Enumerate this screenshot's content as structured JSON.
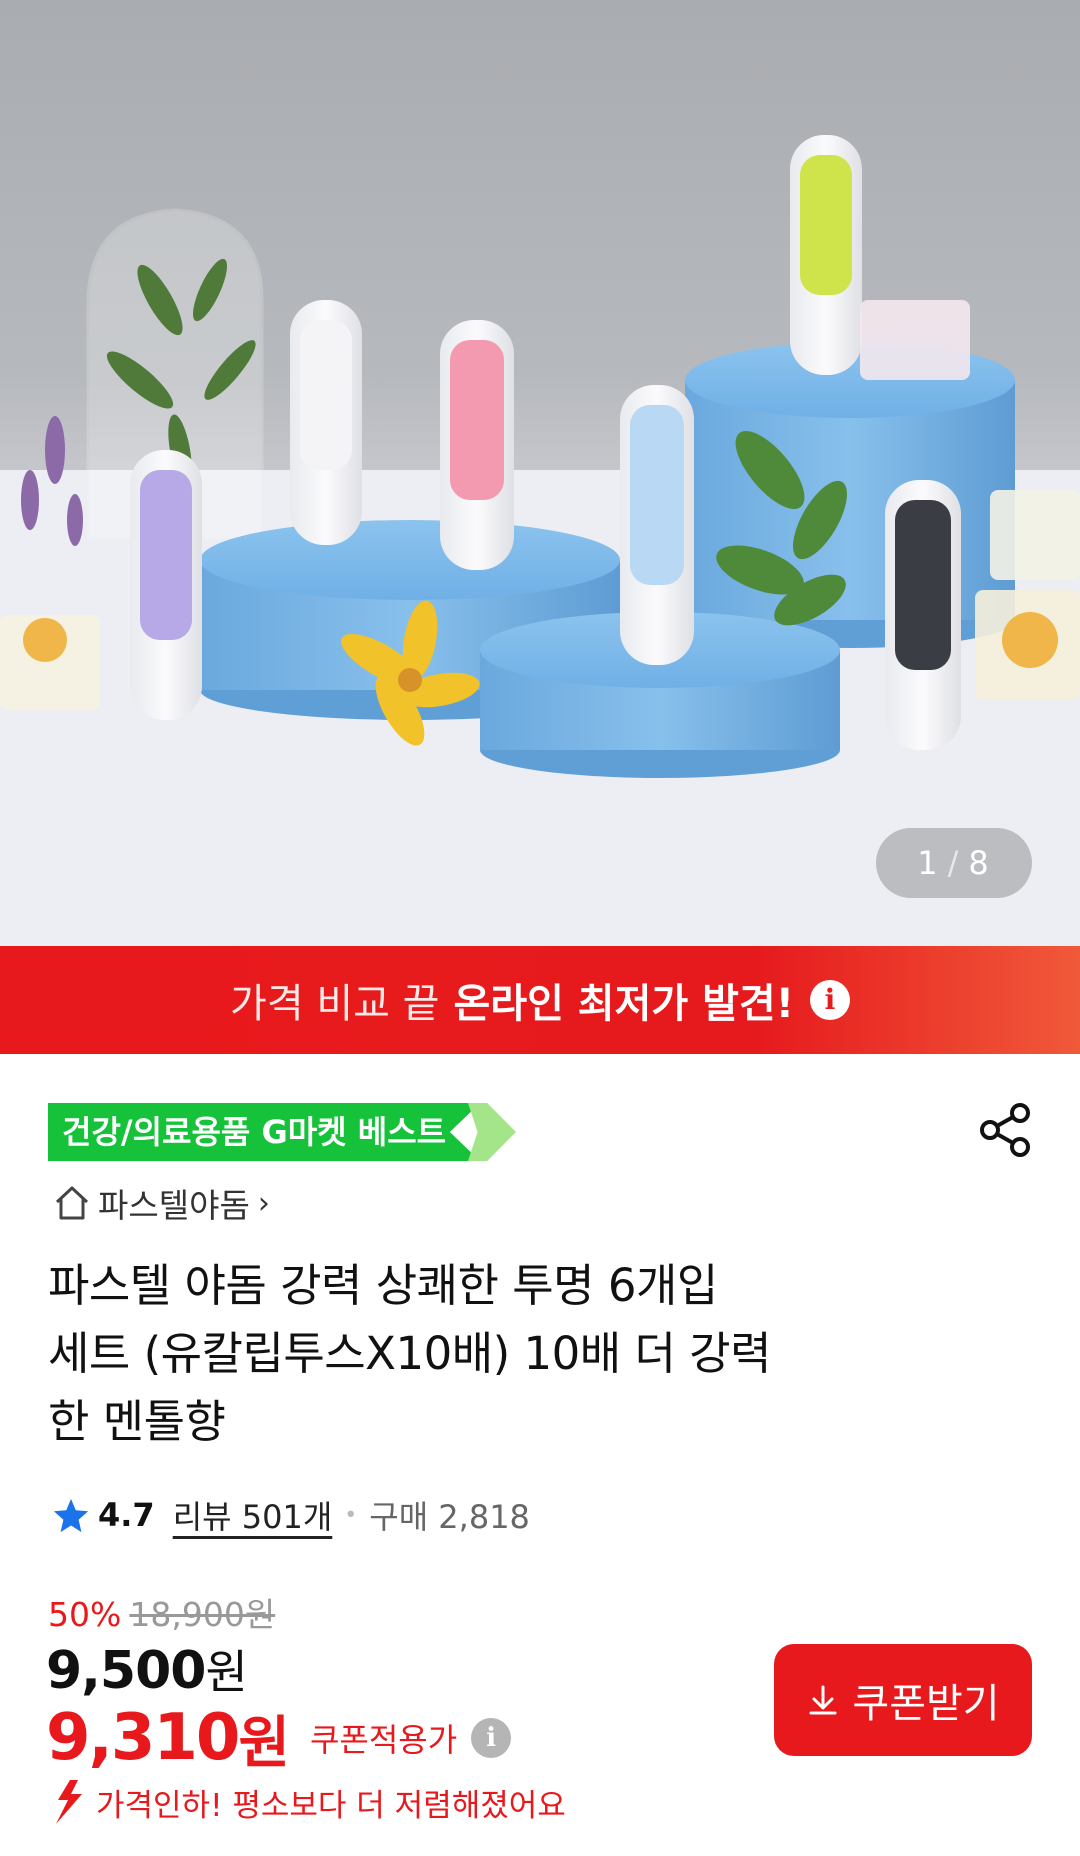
{
  "gallery": {
    "current": "1",
    "separator": "/",
    "total": "8"
  },
  "banner": {
    "light_text": "가격 비교 끝",
    "bold_text": "온라인 최저가 발견!",
    "info_icon": "info-icon"
  },
  "badge": {
    "label": "건강/의료용품 G마켓 베스트"
  },
  "share": {
    "icon": "share-icon"
  },
  "store": {
    "name": "파스텔야돔",
    "icon": "home-icon"
  },
  "product": {
    "title_line1": "파스텔 야돔 강력 상쾌한 투명 6개입",
    "title_line2": "세트 (유칼립투스X10배) 10배 더 강력",
    "title_line3": "한 멘톨향"
  },
  "rating": {
    "score": "4.7",
    "review": "리뷰 501개",
    "purchase": "구매 2,818"
  },
  "price": {
    "discount": "50%",
    "original": "18,900원",
    "sale": "9,500",
    "sale_unit": "원",
    "coupon_amount": "9,310",
    "coupon_unit": "원",
    "coupon_label": "쿠폰적용가"
  },
  "coupon_button": {
    "label": "쿠폰받기"
  },
  "price_drop": {
    "text": "가격인하! 평소보다 더 저렴해졌어요"
  },
  "colors": {
    "accent_red": "#e8191c",
    "badge_green": "#16c23a",
    "pedestal_blue": "#7db5e6"
  }
}
